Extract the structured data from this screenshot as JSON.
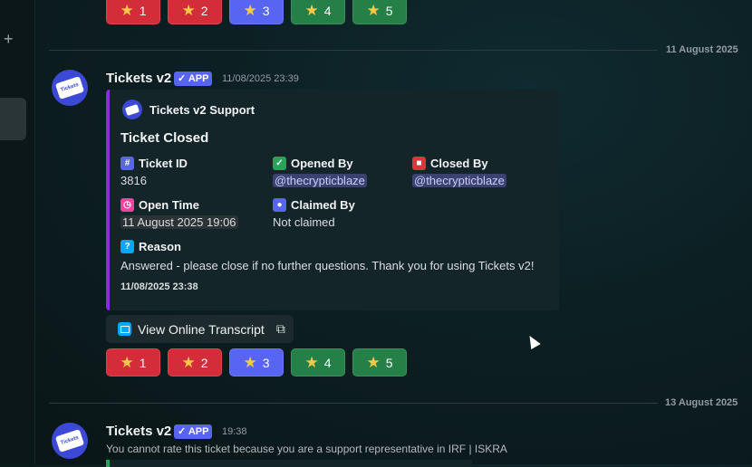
{
  "rating_buttons": [
    {
      "label": "1",
      "color": "#d22d39"
    },
    {
      "label": "2",
      "color": "#d22d39"
    },
    {
      "label": "3",
      "color": "#5865f2"
    },
    {
      "label": "4",
      "color": "#248046"
    },
    {
      "label": "5",
      "color": "#248046"
    }
  ],
  "dividers": {
    "first": "11 August 2025",
    "second": "13 August 2025"
  },
  "message1": {
    "username": "Tickets v2",
    "app_badge": "✓ APP",
    "timestamp": "11/08/2025 23:39",
    "embed": {
      "author": "Tickets v2 Support",
      "title": "Ticket Closed",
      "fields": {
        "ticket_id": {
          "name": "Ticket ID",
          "value": "3816"
        },
        "opened_by": {
          "name": "Opened By",
          "value": "@thecrypticblaze"
        },
        "closed_by": {
          "name": "Closed By",
          "value": "@thecrypticblaze"
        },
        "open_time": {
          "name": "Open Time",
          "value": "11 August 2025 19:06"
        },
        "claimed_by": {
          "name": "Claimed By",
          "value": "Not claimed"
        },
        "reason": {
          "name": "Reason",
          "value": "Answered - please close if no further questions. Thank you for using Tickets v2!"
        }
      },
      "footer": "11/08/2025 23:38",
      "accent_color": "#8a2be2"
    },
    "transcript_button": "View Online Transcript"
  },
  "message2": {
    "username": "Tickets v2",
    "app_badge": "✓ APP",
    "timestamp": "19:38",
    "text": "You cannot rate this ticket because you are a support representative in IRF | ISKRA"
  },
  "avatar_text": "Tickets"
}
